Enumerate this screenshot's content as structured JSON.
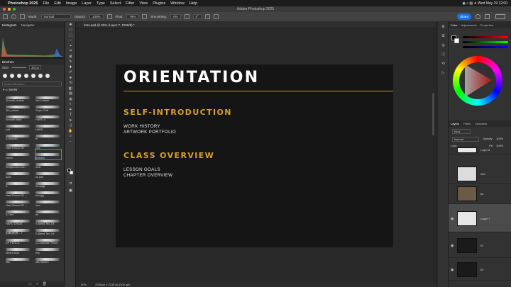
{
  "menubar": {
    "app": "Photoshop 2025",
    "items": [
      "File",
      "Edit",
      "Image",
      "Layer",
      "Type",
      "Select",
      "Filter",
      "View",
      "Plugins",
      "Window",
      "Help"
    ],
    "right": "◉ ⌕ ▤ ✦ Wed May 29 12:00"
  },
  "window": {
    "title": "Adobe Photoshop 2025"
  },
  "options": {
    "mode_label": "Mode:",
    "mode_value": "Normal",
    "opacity_label": "Opacity:",
    "opacity_value": "100%",
    "flow_label": "Flow:",
    "flow_value": "79%",
    "smoothing_label": "Smoothing:",
    "smoothing_value": "0%",
    "angle_value": "0°",
    "share_label": "Share"
  },
  "left_panel": {
    "tabs": [
      "Histogram",
      "Navigator"
    ],
    "brushes_title": "Brushes",
    "size_label": "Size:",
    "size_value": "30 px",
    "tip_sizes": [
      "20",
      "30",
      "30",
      "25",
      "25",
      "25",
      "25"
    ],
    "search_placeholder": "Search Brushes",
    "group_name": "MAIN",
    "brushes": [
      {
        "left": "Smooth_eraser",
        "right": "hard eraser"
      },
      {
        "left": "Tex_eraser",
        "right": "Super Soft"
      },
      {
        "left": "Smooth static",
        "right": "HARD c"
      },
      {
        "left": "soft",
        "right": "HARD"
      },
      {
        "left": "S.Smooth",
        "right": "bl"
      },
      {
        "left": "Hard Round 30",
        "right": "Grd"
      },
      {
        "left": "comic",
        "right": "blobase"
      },
      {
        "left": "Softpencermme...",
        "right": "oroll"
      },
      {
        "left": "ACE",
        "right": "sk poll"
      },
      {
        "left": "S",
        "right": "Smudge"
      },
      {
        "left": "Hard Round 30 ...",
        "right": "bmugg"
      },
      {
        "left": "Hard Round 30 ...",
        "right": "ono"
      },
      {
        "left": "S-Text",
        "right": "bk"
      },
      {
        "left": "HARD DRAW",
        "right": "S.Blend Tex_04"
      },
      {
        "left": "鉛筆(硬)感 - T",
        "right": "S.Blend Tex_03"
      },
      {
        "left": "DP PENCIL",
        "right": "Q Charcoal Pencil"
      },
      {
        "left": "sketch bold",
        "right": "esk"
      },
      {
        "left": "MB",
        "right": "MB-Sketch"
      }
    ]
  },
  "document": {
    "tab": "intro.psd @ 50% (Layer 7, RGB/8) *",
    "status_zoom": "50%",
    "status_info": "3788 px x 2130 px (300 ppi)"
  },
  "canvas": {
    "title": "ORIENTATION",
    "section1_heading": "SELF-INTRODUCTION",
    "section1_line1": "WORK HISTORY",
    "section1_line2": "ARTWORK PORTFOLIO",
    "section2_heading": "CLASS OVERVIEW",
    "section2_line1": "LESSON GOALS",
    "section2_line2": "CHAPTER OVERVIEW",
    "bullet": "•"
  },
  "right_panel": {
    "color_tabs": [
      "Color",
      "Adjustments",
      "Properties"
    ],
    "layer_tabs": [
      "Layers",
      "Paths",
      "Channels"
    ],
    "filter_value": "Kind",
    "blend_value": "Normal",
    "opacity_label": "Opacity:",
    "opacity_value": "100%",
    "lock_label": "Lock:",
    "fill_label": "Fill:",
    "fill_value": "100%",
    "layers": [
      {
        "name": "Layer 8",
        "thumb": "#e8e8e8"
      },
      {
        "name": "000",
        "thumb": "#dcdcdc"
      },
      {
        "name": "bb",
        "thumb": "#6b5a45"
      },
      {
        "name": "Layer 7",
        "thumb": "#e6e6e6"
      },
      {
        "name": "01",
        "thumb": "#1a1a1a"
      },
      {
        "name": "02",
        "thumb": "#1a1a1a"
      }
    ]
  },
  "colors": {
    "accent": "#d8a02c",
    "canvas_bg": "#151515",
    "share": "#1473e6"
  }
}
